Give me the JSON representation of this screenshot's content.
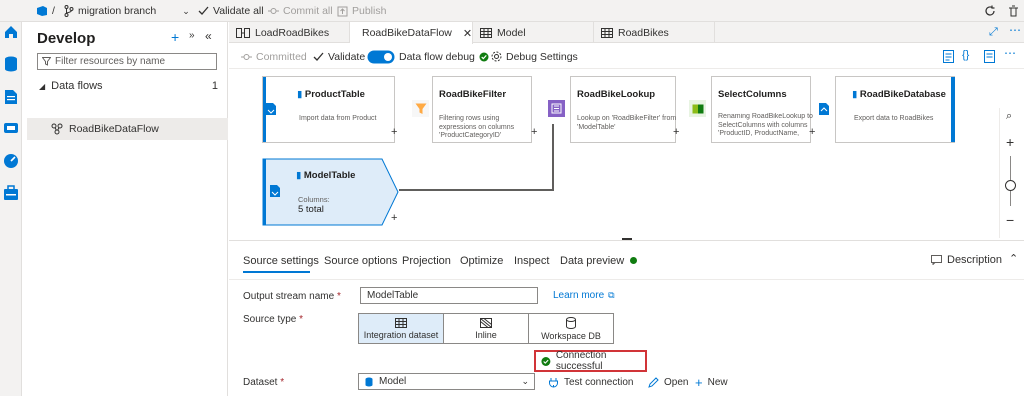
{
  "topbar": {
    "repo_separator": "/",
    "branch": "migration branch",
    "validate_all": "Validate all",
    "commit_all": "Commit all",
    "publish": "Publish"
  },
  "develop": {
    "title": "Develop",
    "filter_placeholder": "Filter resources by name",
    "section_label": "Data flows",
    "section_count": "1",
    "item_label": "RoadBikeDataFlow"
  },
  "tabs": [
    {
      "label": "LoadRoadBikes"
    },
    {
      "label": "RoadBikeDataFlow"
    },
    {
      "label": "Model"
    },
    {
      "label": "RoadBikes"
    }
  ],
  "toolbar": {
    "committed": "Committed",
    "validate": "Validate",
    "data_flow_debug": "Data flow debug",
    "debug_settings": "Debug Settings"
  },
  "nodes": {
    "product_table": {
      "title": "ProductTable",
      "desc": "Import data from Product"
    },
    "filter": {
      "title": "RoadBikeFilter",
      "desc": "Filtering rows using expressions on columns 'ProductCategoryID'"
    },
    "lookup": {
      "title": "RoadBikeLookup",
      "desc": "Lookup on 'RoadBikeFilter' from 'ModelTable'"
    },
    "select": {
      "title": "SelectColumns",
      "desc": "Renaming RoadBikeLookup to SelectColumns with columns 'ProductID, ProductName,"
    },
    "sink": {
      "title": "RoadBikeDatabase",
      "desc": "Export data to RoadBikes"
    },
    "model_table": {
      "title": "ModelTable",
      "columns_label": "Columns:",
      "columns_value": "5 total"
    }
  },
  "props": {
    "tabs": [
      "Source settings",
      "Source options",
      "Projection",
      "Optimize",
      "Inspect",
      "Data preview"
    ],
    "description": "Description",
    "output_stream_label": "Output stream name",
    "output_stream_value": "ModelTable",
    "learn_more": "Learn more",
    "source_type_label": "Source type",
    "source_types": [
      "Integration dataset",
      "Inline",
      "Workspace DB"
    ],
    "connection_status": "Connection successful",
    "dataset_label": "Dataset",
    "dataset_value": "Model",
    "test_connection": "Test connection",
    "open": "Open",
    "new": "New",
    "required_mark": "*"
  },
  "colors": {
    "accent": "#0078d4",
    "success": "#107c10",
    "highlight_border": "#d13438",
    "selected_node_bg": "#deecf9"
  }
}
